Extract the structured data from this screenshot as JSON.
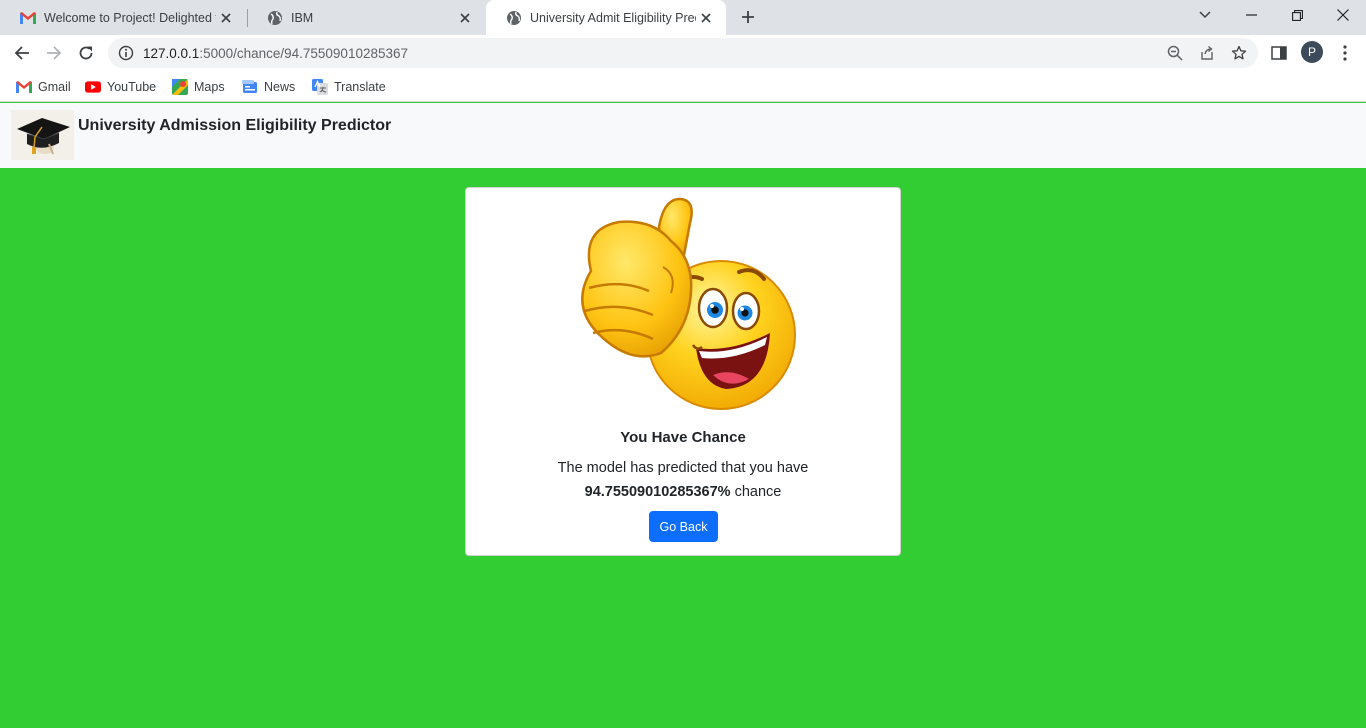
{
  "browser": {
    "tabs": [
      {
        "title": "Welcome to Project! Delighted to",
        "favicon": "gmail-icon",
        "active": false
      },
      {
        "title": "IBM",
        "favicon": "globe-icon",
        "active": false
      },
      {
        "title": "University Admit Eligibility Predictor",
        "favicon": "globe-icon",
        "active": true
      }
    ],
    "url_host": "127.0.0.1",
    "url_path": ":5000/chance/94.75509010285367",
    "avatar_letter": "P",
    "bookmarks": [
      {
        "label": "Gmail",
        "icon": "gmail-icon"
      },
      {
        "label": "YouTube",
        "icon": "youtube-icon"
      },
      {
        "label": "Maps",
        "icon": "maps-icon"
      },
      {
        "label": "News",
        "icon": "news-icon"
      },
      {
        "label": "Translate",
        "icon": "translate-icon"
      }
    ]
  },
  "navbar": {
    "brand": "University Admission Eligibility Predictor",
    "logo": "graduation-cap-icon"
  },
  "result": {
    "image": "thumbs-up-emoji",
    "title": "You Have Chance",
    "text_before": "The model has predicted that you have",
    "chance": "94.75509010285367%",
    "text_after": "chance",
    "button": "Go Back"
  },
  "colors": {
    "page_background": "#32cd32",
    "button": "#0d6efd",
    "navbar": "#f8f9fa"
  }
}
